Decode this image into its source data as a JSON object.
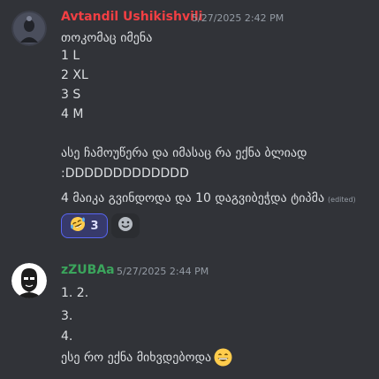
{
  "messages": [
    {
      "author": "Avtandil Ushikishvili",
      "author_color": "#f23f43",
      "timestamp": "5/27/2025 2:42 PM",
      "lines": [
        "თოკომაც იმენა",
        "1 L",
        "2 XL",
        "3 S",
        "4 M"
      ],
      "lines2": [
        "ასე ჩამოუწერა და იმასაც რა ექნა ბლიად",
        ":DDDDDDDDDDDDD"
      ],
      "last_line": "4 მაიკა გვინდოდა და 10 დაგვიბეჭდა ტიპმა",
      "edited_label": "(edited)",
      "reactions": [
        {
          "emoji": "rolling-on-floor-laughing",
          "count": "3",
          "active": true
        },
        {
          "emoji": "add-reaction",
          "count": "",
          "active": false
        }
      ]
    },
    {
      "author": "zZUBAa",
      "author_color": "#3ba55c",
      "timestamp": "5/27/2025 2:44 PM",
      "lines": [
        "1. 2.",
        "3.",
        "4."
      ],
      "last_line": "ესე რო ექნა მიხვდებოდა",
      "trailing_emoji": "grinning-smile"
    }
  ]
}
